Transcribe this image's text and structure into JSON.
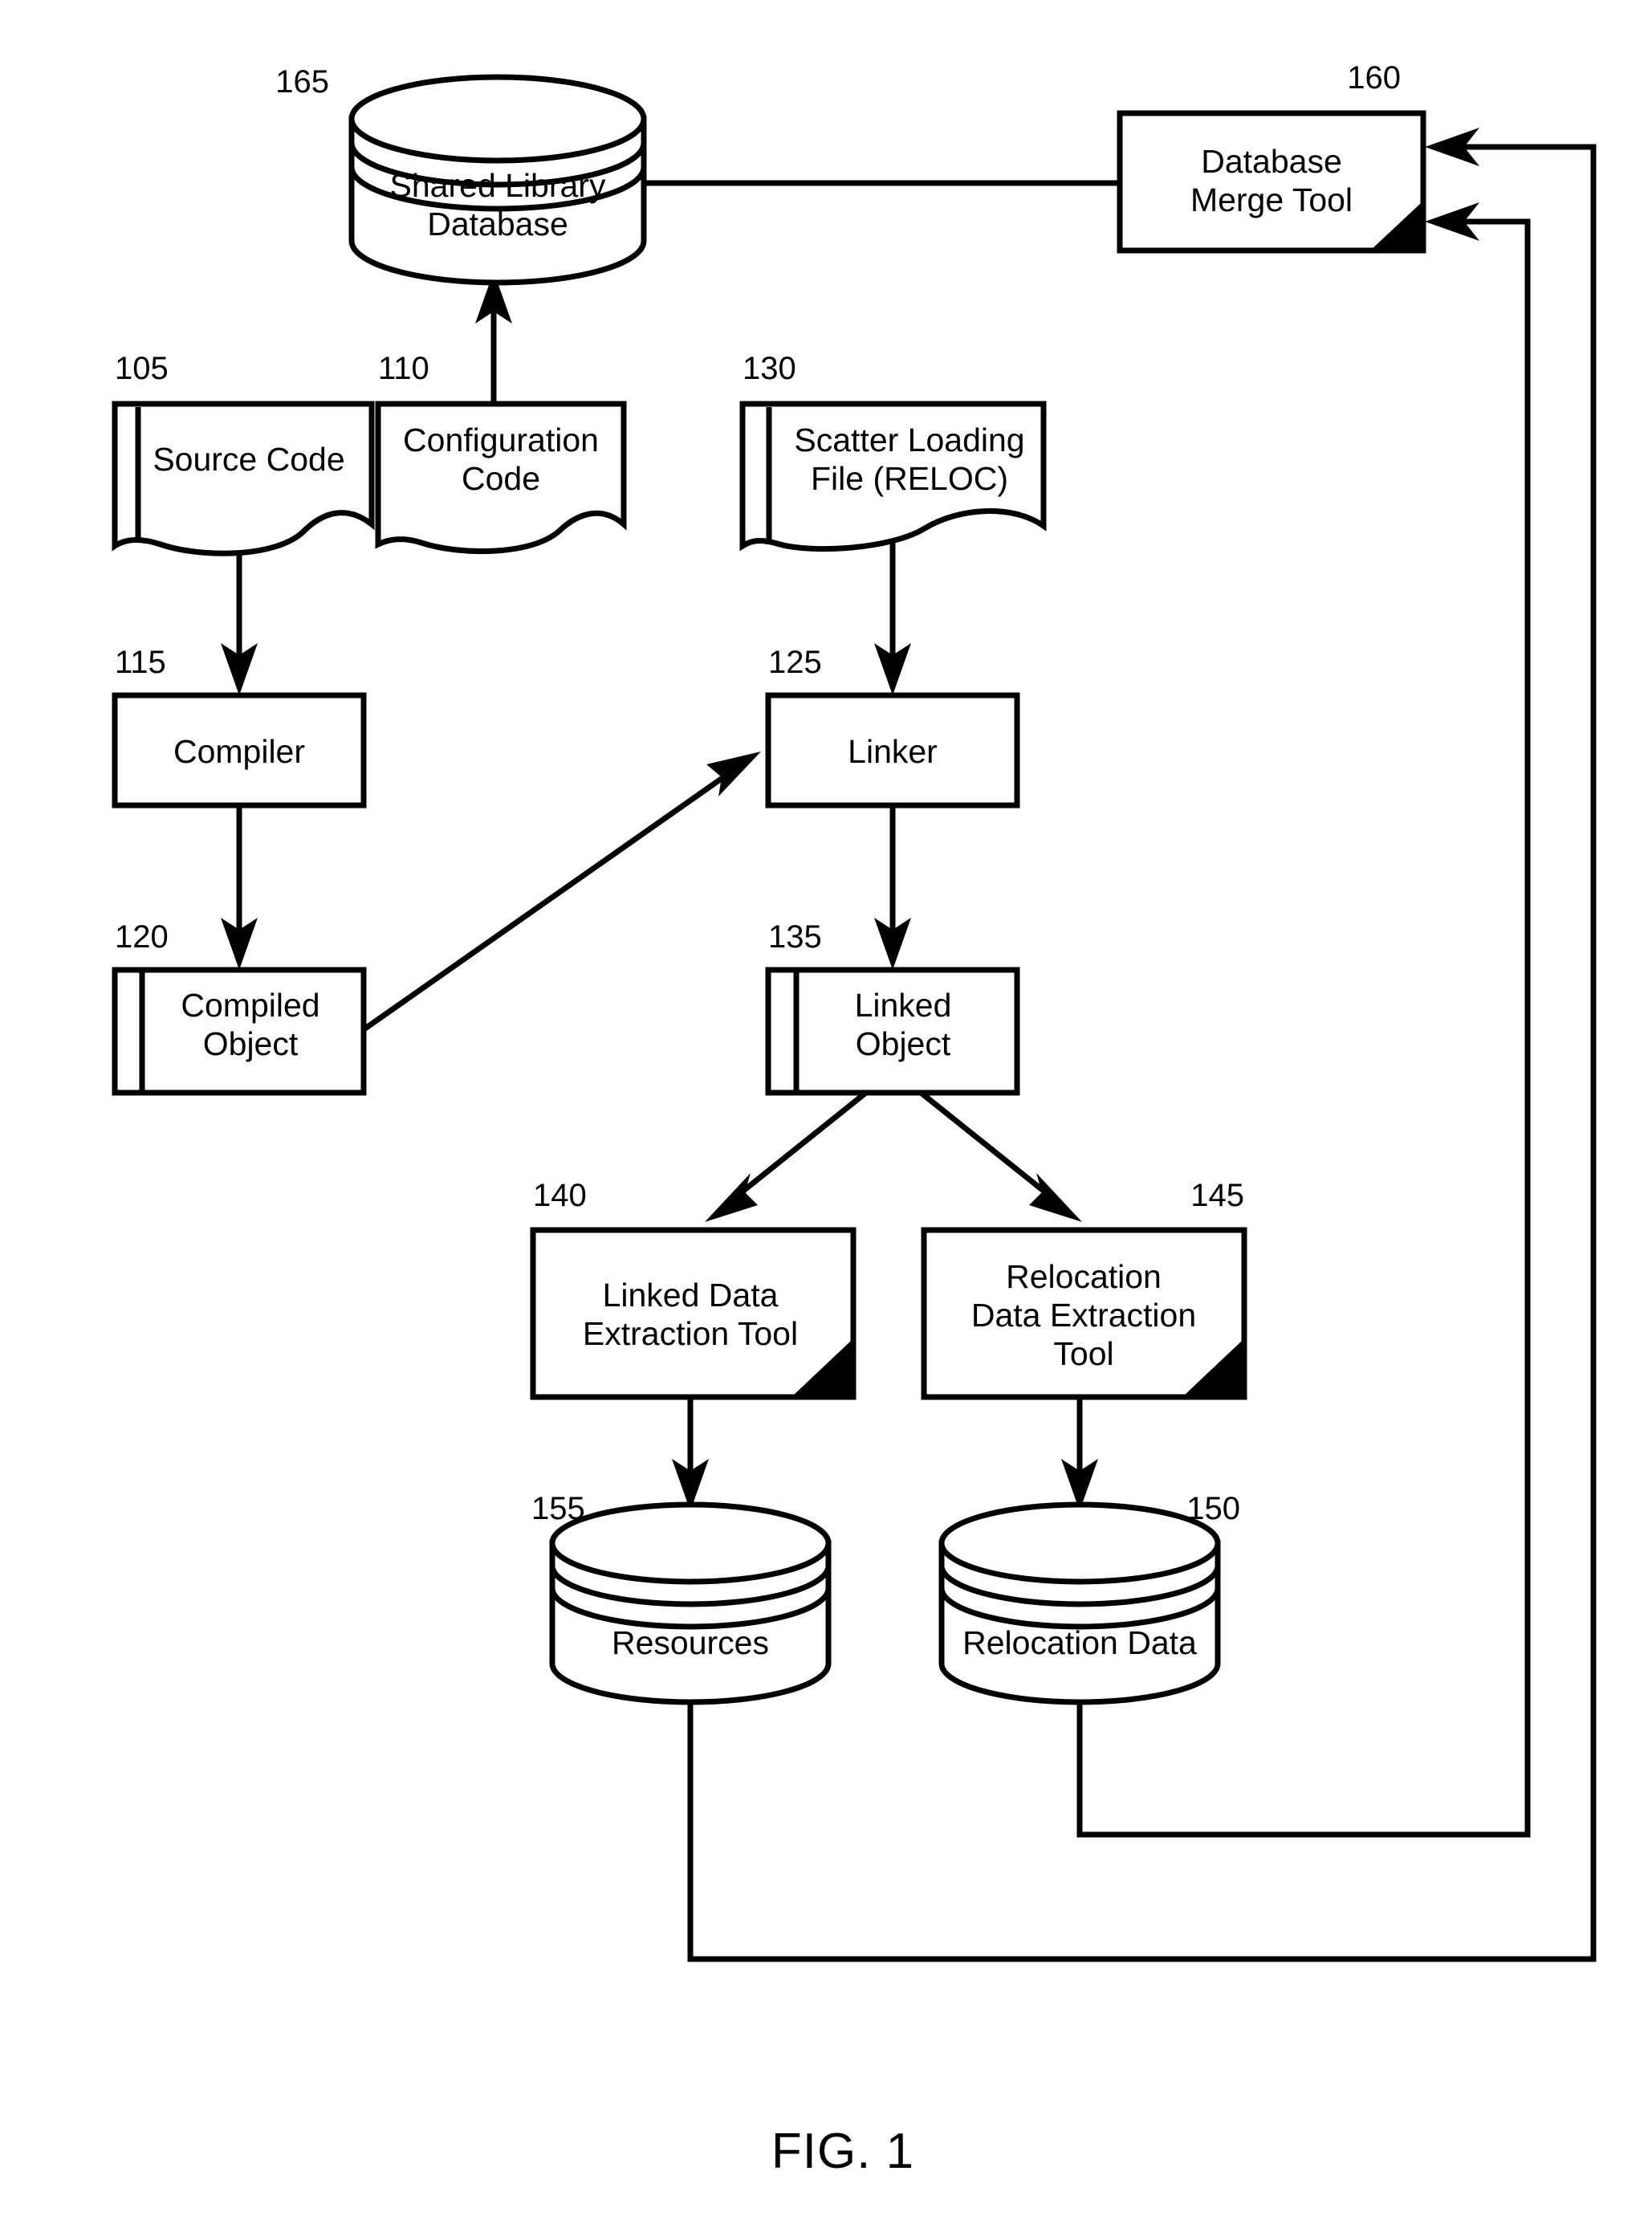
{
  "figure": {
    "caption": "FIG. 1",
    "title": "Shared library database build flow diagram"
  },
  "nodes": {
    "shared_library_database": {
      "ref": "165",
      "label_line1": "Shared Library",
      "label_line2": "Database",
      "shape": "cylinder"
    },
    "database_merge_tool": {
      "ref": "160",
      "label_line1": "Database",
      "label_line2": "Merge Tool",
      "shape": "tool-box"
    },
    "source_code": {
      "ref": "105",
      "label_line1": "Source Code",
      "label_line2": "",
      "shape": "document"
    },
    "configuration_code": {
      "ref": "110",
      "label_line1": "Configuration",
      "label_line2": "Code",
      "shape": "document"
    },
    "scatter_loading_file": {
      "ref": "130",
      "label_line1": "Scatter Loading",
      "label_line2": "File (RELOC)",
      "shape": "document"
    },
    "compiler": {
      "ref": "115",
      "label_line1": "Compiler",
      "label_line2": "",
      "shape": "box"
    },
    "linker": {
      "ref": "125",
      "label_line1": "Linker",
      "label_line2": "",
      "shape": "box"
    },
    "compiled_object": {
      "ref": "120",
      "label_line1": "Compiled",
      "label_line2": "Object",
      "shape": "object-box"
    },
    "linked_object": {
      "ref": "135",
      "label_line1": "Linked",
      "label_line2": "Object",
      "shape": "object-box"
    },
    "linked_data_extraction_tool": {
      "ref": "140",
      "label_line1": "Linked Data",
      "label_line2": "Extraction Tool",
      "label_line3": "",
      "shape": "tool-box"
    },
    "relocation_data_extraction_tool": {
      "ref": "145",
      "label_line1": "Relocation",
      "label_line2": "Data Extraction",
      "label_line3": "Tool",
      "shape": "tool-box"
    },
    "resources": {
      "ref": "155",
      "label_line1": "Resources",
      "label_line2": "",
      "shape": "cylinder"
    },
    "relocation_data": {
      "ref": "150",
      "label_line1": "Relocation Data",
      "label_line2": "",
      "shape": "cylinder"
    }
  },
  "connections": [
    {
      "from": "database_merge_tool",
      "to": "shared_library_database"
    },
    {
      "from": "configuration_code",
      "to": "shared_library_database"
    },
    {
      "from": "source_code",
      "to": "compiler"
    },
    {
      "from": "compiler",
      "to": "compiled_object"
    },
    {
      "from": "compiled_object",
      "to": "linker"
    },
    {
      "from": "scatter_loading_file",
      "to": "linker"
    },
    {
      "from": "linker",
      "to": "linked_object"
    },
    {
      "from": "linked_object",
      "to": "linked_data_extraction_tool"
    },
    {
      "from": "linked_object",
      "to": "relocation_data_extraction_tool"
    },
    {
      "from": "linked_data_extraction_tool",
      "to": "resources"
    },
    {
      "from": "relocation_data_extraction_tool",
      "to": "relocation_data"
    },
    {
      "from": "relocation_data",
      "to": "database_merge_tool"
    },
    {
      "from": "resources",
      "to": "database_merge_tool"
    }
  ],
  "style": {
    "stroke_color": "#000000",
    "fill_color": "#ffffff",
    "fold_color": "#000000"
  }
}
